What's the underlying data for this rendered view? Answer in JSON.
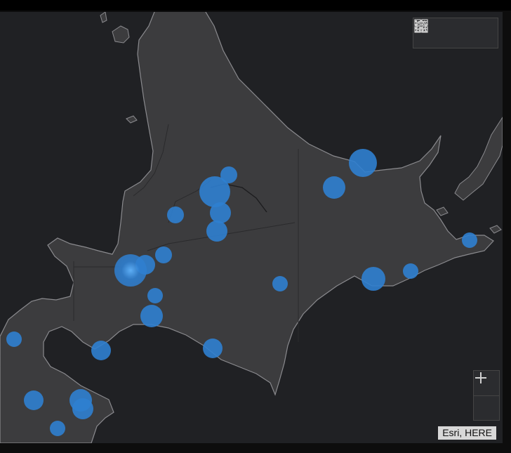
{
  "map": {
    "land_color": "#3c3c3e",
    "water_color": "#202124",
    "symbol_color": "#2f7fd0"
  },
  "toolbar": {
    "home_icon": "home-icon",
    "legend_icon": "list-icon",
    "basemap_icon": "basemap-gallery-icon"
  },
  "zoom": {
    "in_label": "+",
    "out_label": "−"
  },
  "attribution": "Esri, HERE"
}
